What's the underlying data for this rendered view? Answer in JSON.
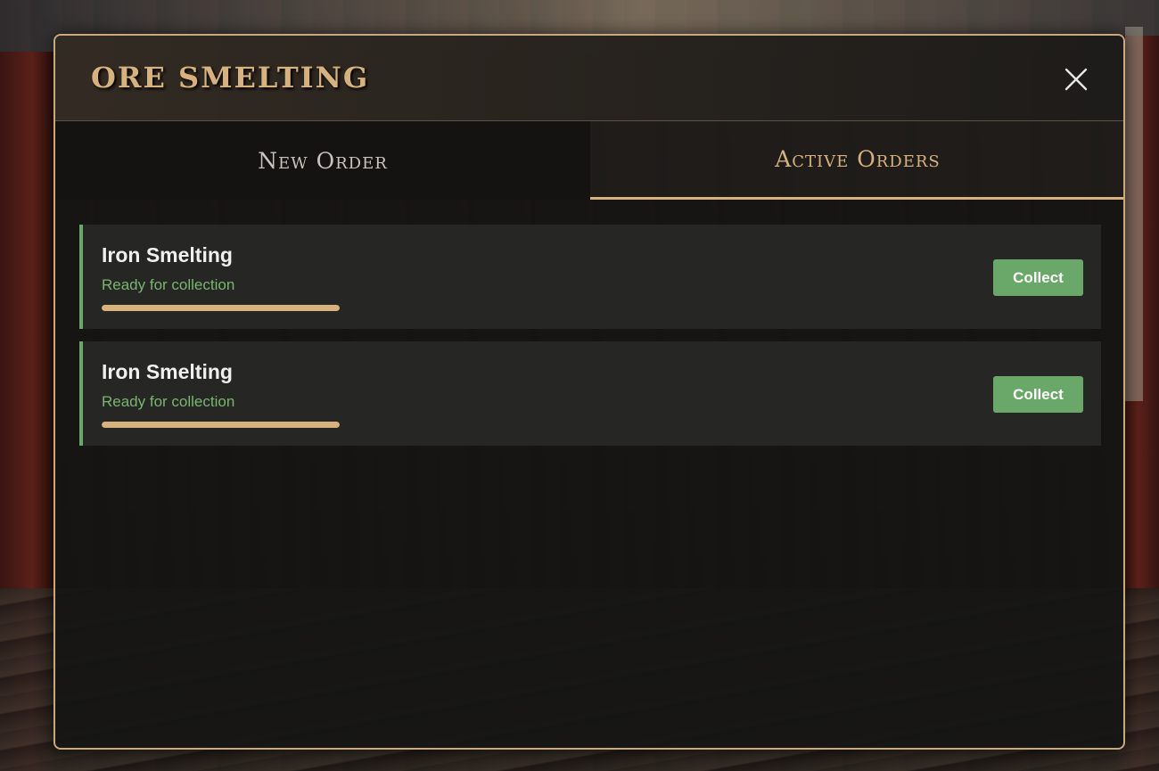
{
  "modal": {
    "title": "ORE SMELTING",
    "close_icon": "close-icon"
  },
  "tabs": [
    {
      "label": "New Order",
      "active": false
    },
    {
      "label": "Active Orders",
      "active": true
    }
  ],
  "orders": [
    {
      "name": "Iron Smelting",
      "status": "Ready for collection",
      "progress": 1.0,
      "action_label": "Collect"
    },
    {
      "name": "Iron Smelting",
      "status": "Ready for collection",
      "progress": 1.0,
      "action_label": "Collect"
    }
  ],
  "colors": {
    "accent_gold": "#d7b27e",
    "ready_green": "#6aa86a",
    "status_green": "#78b66d",
    "progress_fill": "#d8b27c"
  }
}
